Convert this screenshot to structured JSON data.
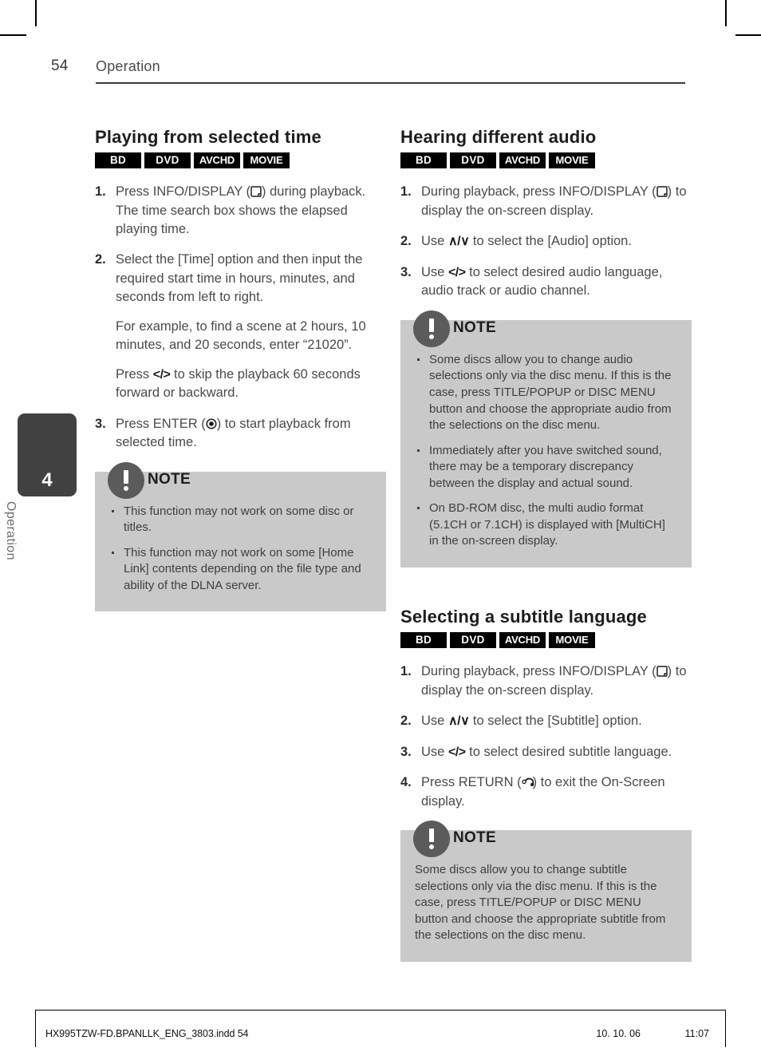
{
  "header": {
    "page_number": "54",
    "title": "Operation"
  },
  "side_tab": {
    "chapter_number": "4",
    "label": "Operation"
  },
  "badges": [
    "BD",
    "DVD",
    "AVCHD",
    "MOVIE"
  ],
  "left_column": {
    "section_title": "Playing from selected time",
    "steps": [
      {
        "num": "1.",
        "parts": [
          {
            "t": "text",
            "v": "Press INFO/DISPLAY ("
          },
          {
            "t": "icon",
            "v": "info-display-icon"
          },
          {
            "t": "text",
            "v": ") during playback. The time search box shows the elapsed playing time."
          }
        ]
      },
      {
        "num": "2.",
        "parts": [
          {
            "t": "text",
            "v": "Select the [Time] option and then input the required start time in hours, minutes, and seconds from left to right."
          }
        ],
        "sub_paragraphs": [
          {
            "parts": [
              {
                "t": "text",
                "v": "For example, to find a scene at 2 hours, 10 minutes, and 20 seconds, enter “21020”."
              }
            ]
          },
          {
            "parts": [
              {
                "t": "text",
                "v": "Press "
              },
              {
                "t": "key",
                "v": "</>"
              },
              {
                "t": "text",
                "v": " to skip the playback 60 seconds forward or backward."
              }
            ]
          }
        ]
      },
      {
        "num": "3.",
        "parts": [
          {
            "t": "text",
            "v": "Press ENTER ("
          },
          {
            "t": "icon",
            "v": "enter-icon"
          },
          {
            "t": "text",
            "v": ") to start playback from selected time."
          }
        ]
      }
    ],
    "note": {
      "title": "NOTE",
      "bullets": [
        "This function may not work on some disc or titles.",
        "This function may not work on some [Home Link] contents depending on the file type and ability of the DLNA server."
      ]
    }
  },
  "right_column": {
    "audio_section": {
      "section_title": "Hearing different audio",
      "steps": [
        {
          "num": "1.",
          "parts": [
            {
              "t": "text",
              "v": "During playback, press INFO/DISPLAY ("
            },
            {
              "t": "icon",
              "v": "info-display-icon"
            },
            {
              "t": "text",
              "v": ") to display the on-screen display."
            }
          ]
        },
        {
          "num": "2.",
          "parts": [
            {
              "t": "text",
              "v": "Use "
            },
            {
              "t": "key",
              "v": "∧/∨"
            },
            {
              "t": "text",
              "v": " to select the [Audio] option."
            }
          ]
        },
        {
          "num": "3.",
          "parts": [
            {
              "t": "text",
              "v": "Use "
            },
            {
              "t": "key",
              "v": "</>"
            },
            {
              "t": "text",
              "v": " to select desired audio language, audio track or audio channel."
            }
          ]
        }
      ],
      "note": {
        "title": "NOTE",
        "bullets": [
          "Some discs allow you to change audio selections only via the disc menu. If this is the case, press TITLE/POPUP or DISC MENU button and choose the appropriate audio from the selections on the disc menu.",
          "Immediately after you have switched sound, there may be a temporary discrepancy between the display and actual sound.",
          "On BD-ROM disc, the multi audio format (5.1CH or 7.1CH) is displayed with [MultiCH] in the on-screen display."
        ]
      }
    },
    "subtitle_section": {
      "section_title": "Selecting a subtitle language",
      "steps": [
        {
          "num": "1.",
          "parts": [
            {
              "t": "text",
              "v": "During playback, press INFO/DISPLAY ("
            },
            {
              "t": "icon",
              "v": "info-display-icon"
            },
            {
              "t": "text",
              "v": ") to display the on-screen display."
            }
          ]
        },
        {
          "num": "2.",
          "parts": [
            {
              "t": "text",
              "v": "Use "
            },
            {
              "t": "key",
              "v": "∧/∨"
            },
            {
              "t": "text",
              "v": " to select the [Subtitle] option."
            }
          ]
        },
        {
          "num": "3.",
          "parts": [
            {
              "t": "text",
              "v": "Use "
            },
            {
              "t": "key",
              "v": "</>"
            },
            {
              "t": "text",
              "v": " to select desired subtitle language."
            }
          ]
        },
        {
          "num": "4.",
          "parts": [
            {
              "t": "text",
              "v": "Press RETURN ("
            },
            {
              "t": "icon",
              "v": "return-icon"
            },
            {
              "t": "text",
              "v": ") to exit the On-Screen display."
            }
          ]
        }
      ],
      "note": {
        "title": "NOTE",
        "paragraph": "Some discs allow you to change subtitle selections only via the disc menu. If this is the case, press TITLE/POPUP or DISC MENU button and choose the appropriate subtitle from the selections on the disc menu."
      }
    }
  },
  "footer": {
    "filename": "HX995TZW-FD.BPANLLK_ENG_3803.indd   54",
    "date": "10. 10. 06",
    "time": "11:07"
  },
  "colors": {
    "note_bg": "#c9c9c9",
    "note_badge": "#5b5b5b",
    "side_tab": "#414141",
    "badge_bg": "#000000",
    "body_text": "#4a4a4a"
  }
}
